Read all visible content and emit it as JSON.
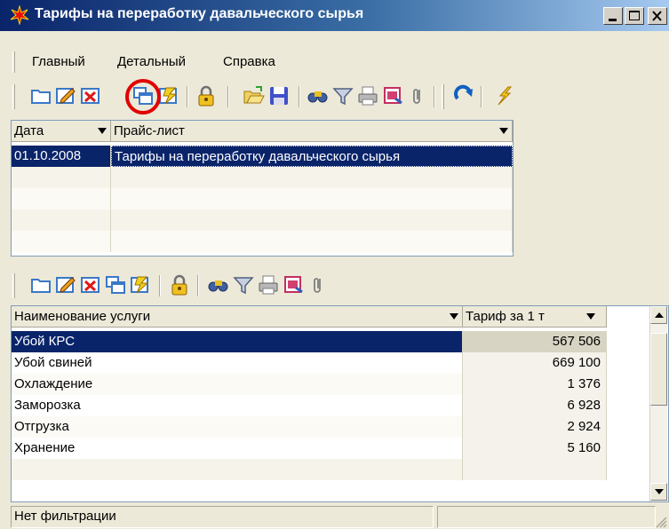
{
  "window": {
    "title": "Тарифы на переработку давальческого сырья"
  },
  "title_buttons": [
    "minimize-icon",
    "maximize-icon",
    "close-icon"
  ],
  "menu": [
    {
      "label": "Главный"
    },
    {
      "label": "Детальный"
    },
    {
      "label": "Справка"
    }
  ],
  "toolbar_top": {
    "icons": [
      "new-icon",
      "edit-icon",
      "delete-icon",
      "copy-icon",
      "refresh-icon",
      "lock-icon",
      "open-folder-icon",
      "save-icon",
      "find-icon",
      "filter-icon",
      "print-icon",
      "export-icon",
      "attach-icon",
      "redo-icon",
      "run-icon"
    ]
  },
  "pricelist_grid": {
    "columns": [
      {
        "label": "Дата"
      },
      {
        "label": "Прайс-лист"
      }
    ],
    "rows": [
      {
        "date": "01.10.2008",
        "name": "Тарифы на переработку давальческого сырья",
        "selected": true
      },
      {
        "date": "",
        "name": ""
      },
      {
        "date": "",
        "name": ""
      },
      {
        "date": "",
        "name": ""
      },
      {
        "date": "",
        "name": ""
      }
    ]
  },
  "toolbar_detail": {
    "icons": [
      "new-icon",
      "edit-icon",
      "delete-icon",
      "copy-icon",
      "refresh-icon",
      "lock-icon",
      "find-icon",
      "filter-icon",
      "print-icon",
      "export-icon",
      "attach-icon"
    ]
  },
  "services_grid": {
    "columns": [
      {
        "label": "Наименование услуги"
      },
      {
        "label": "Тариф за 1 т"
      }
    ],
    "rows": [
      {
        "service": "Убой КРС",
        "tariff": "567 506",
        "selected": true
      },
      {
        "service": "Убой свиней",
        "tariff": "669 100"
      },
      {
        "service": "Охлаждение",
        "tariff": "1 376"
      },
      {
        "service": "Заморозка",
        "tariff": "6 928"
      },
      {
        "service": "Отгрузка",
        "tariff": "2 924"
      },
      {
        "service": "Хранение",
        "tariff": "5 160"
      },
      {
        "service": "",
        "tariff": ""
      }
    ]
  },
  "status": {
    "filter_text": "Нет фильтрации",
    "second_panel": ""
  },
  "colors": {
    "title_start": "#0a246a",
    "title_end": "#a6caf0",
    "selection": "#0a246a",
    "highlight_ring": "#e00000"
  }
}
